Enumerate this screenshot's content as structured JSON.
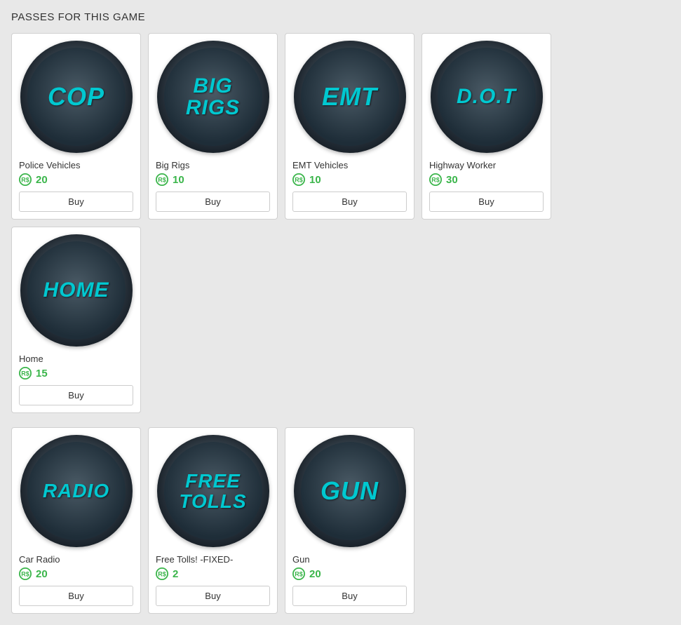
{
  "page": {
    "title": "PASSES FOR THIS GAME"
  },
  "passes": [
    {
      "id": "cop",
      "icon_text": "COP",
      "name": "Police Vehicles",
      "price": 20,
      "font_size": "36px"
    },
    {
      "id": "big-rigs",
      "icon_text": "BIG RIGS",
      "name": "Big Rigs",
      "price": 10,
      "font_size": "30px"
    },
    {
      "id": "emt",
      "icon_text": "EMT",
      "name": "EMT Vehicles",
      "price": 10,
      "font_size": "36px"
    },
    {
      "id": "dot",
      "icon_text": "D.O.T",
      "name": "Highway Worker",
      "price": 30,
      "font_size": "30px"
    },
    {
      "id": "home",
      "icon_text": "HOME",
      "name": "Home",
      "price": 15,
      "font_size": "30px"
    },
    {
      "id": "car-radio",
      "icon_text": "RADIO",
      "name": "Car Radio",
      "price": 20,
      "font_size": "28px"
    },
    {
      "id": "free-tolls",
      "icon_text": "FREE TOLLS",
      "name": "Free Tolls! -FIXED-",
      "price": 2,
      "font_size": "28px"
    },
    {
      "id": "gun",
      "icon_text": "GUN",
      "name": "Gun",
      "price": 20,
      "font_size": "36px"
    }
  ],
  "buttons": {
    "buy": "Buy"
  }
}
